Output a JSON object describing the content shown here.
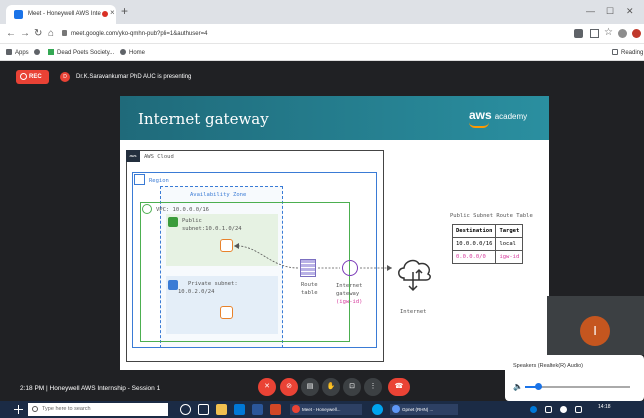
{
  "browser": {
    "tab_title": "Meet - Honeywell AWS Inte",
    "url": "meet.google.com/yko-qmhn-pub?pli=1&authuser=4",
    "bookmarks": [
      "Apps",
      "Dead Poets Society...",
      "Home"
    ],
    "reading_list": "Reading"
  },
  "meet": {
    "rec_label": "REC",
    "presenter_initial": "D",
    "presenter_text": "Dr.K.Saravankumar PhD AUC is presenting",
    "meeting_time": "2:18 PM",
    "meeting_title": "Honeywell AWS Internship - Session 1",
    "tile_initial": "I",
    "audio_device": "Speakers (Realtek(R) Audio)",
    "volume_level": 0.12
  },
  "slide": {
    "title": "Internet gateway",
    "logo_aws": "aws",
    "logo_academy": "academy",
    "aws_cloud": "AWS Cloud",
    "region": "Region",
    "az": "Availability Zone",
    "vpc": "VPC: 10.0.0.0/16",
    "public_subnet_line1": "Public",
    "public_subnet_line2": "subnet:10.0.1.0/24",
    "private_subnet_line1": "Private subnet:",
    "private_subnet_line2": "10.0.2.0/24",
    "route_table_l1": "Route",
    "route_table_l2": "table",
    "igw_l1": "Internet",
    "igw_l2": "gateway",
    "igw_l3": "(igw-id)",
    "internet": "Internet",
    "table_title": "Public Subnet Route Table",
    "table_headers": [
      "Destination",
      "Target"
    ],
    "table_rows": [
      [
        "10.0.0.0/16",
        "local"
      ],
      [
        "0.0.0.0/0",
        "igw-id"
      ]
    ]
  },
  "taskbar": {
    "search_placeholder": "Type here to search",
    "apps": [
      "Meet - Honeywell...",
      "Gpnet (RHN) ..."
    ],
    "clock": "14:18"
  },
  "colors": {
    "slide_header": "#1f6a7a",
    "aws_orange": "#ff9900",
    "meet_red": "#ea4335",
    "route_pink": "#d6389c"
  }
}
